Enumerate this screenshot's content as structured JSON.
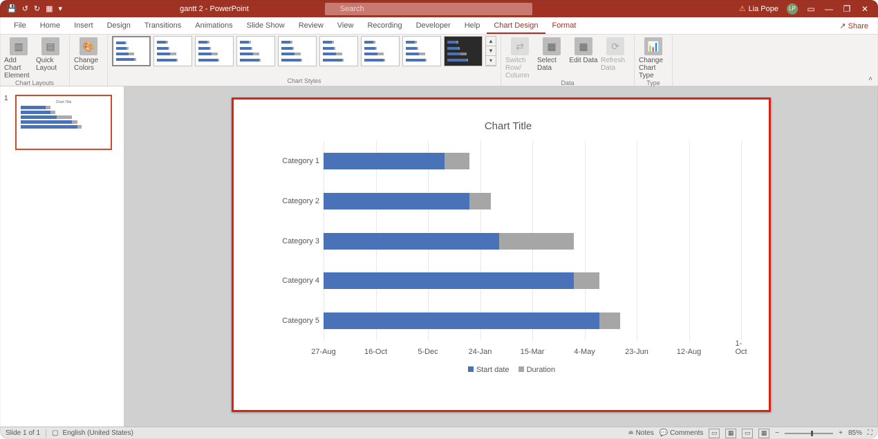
{
  "titlebar": {
    "doc_title": "gantt 2 - PowerPoint",
    "search_placeholder": "Search",
    "user_name": "Lia Pope",
    "user_initials": "LP"
  },
  "ribbon_tabs": {
    "items": [
      "File",
      "Home",
      "Insert",
      "Design",
      "Transitions",
      "Animations",
      "Slide Show",
      "Review",
      "View",
      "Recording",
      "Developer",
      "Help",
      "Chart Design",
      "Format"
    ],
    "active_index": 12,
    "context_start_index": 12,
    "share_label": "Share"
  },
  "ribbon": {
    "groups": {
      "chart_layouts": {
        "label": "Chart Layouts",
        "add_element": "Add Chart Element",
        "quick_layout": "Quick Layout"
      },
      "colors": {
        "label": "",
        "change_colors": "Change Colors"
      },
      "chart_styles": {
        "label": "Chart Styles"
      },
      "data": {
        "label": "Data",
        "switch": "Switch Row/ Column",
        "select": "Select Data",
        "edit": "Edit Data",
        "refresh": "Refresh Data"
      },
      "type": {
        "label": "Type",
        "change_type": "Change Chart Type"
      }
    }
  },
  "thumbs": {
    "slide_number": "1",
    "mini_title": "Chart Title"
  },
  "chart_data": {
    "type": "bar",
    "title": "Chart Title",
    "categories": [
      "Category 1",
      "Category 2",
      "Category 3",
      "Category 4",
      "Category 5"
    ],
    "x_tick_labels": [
      "27-Aug",
      "16-Oct",
      "5-Dec",
      "24-Jan",
      "15-Mar",
      "4-May",
      "23-Jun",
      "12-Aug",
      "1-Oct"
    ],
    "series": [
      {
        "name": "Start date",
        "values_fraction_of_axis": [
          0,
          0,
          0,
          0,
          0
        ]
      },
      {
        "name": "Duration",
        "values_fraction_of_axis": [
          0,
          0,
          0,
          0,
          0
        ]
      }
    ],
    "bars_fraction": [
      {
        "start": 0.29,
        "dur": 0.06
      },
      {
        "start": 0.35,
        "dur": 0.05
      },
      {
        "start": 0.42,
        "dur": 0.18
      },
      {
        "start": 0.6,
        "dur": 0.06
      },
      {
        "start": 0.66,
        "dur": 0.05
      }
    ],
    "legend": [
      "Start date",
      "Duration"
    ]
  },
  "statusbar": {
    "slide_info": "Slide 1 of 1",
    "language": "English (United States)",
    "notes": "Notes",
    "comments": "Comments",
    "zoom": "85%"
  }
}
